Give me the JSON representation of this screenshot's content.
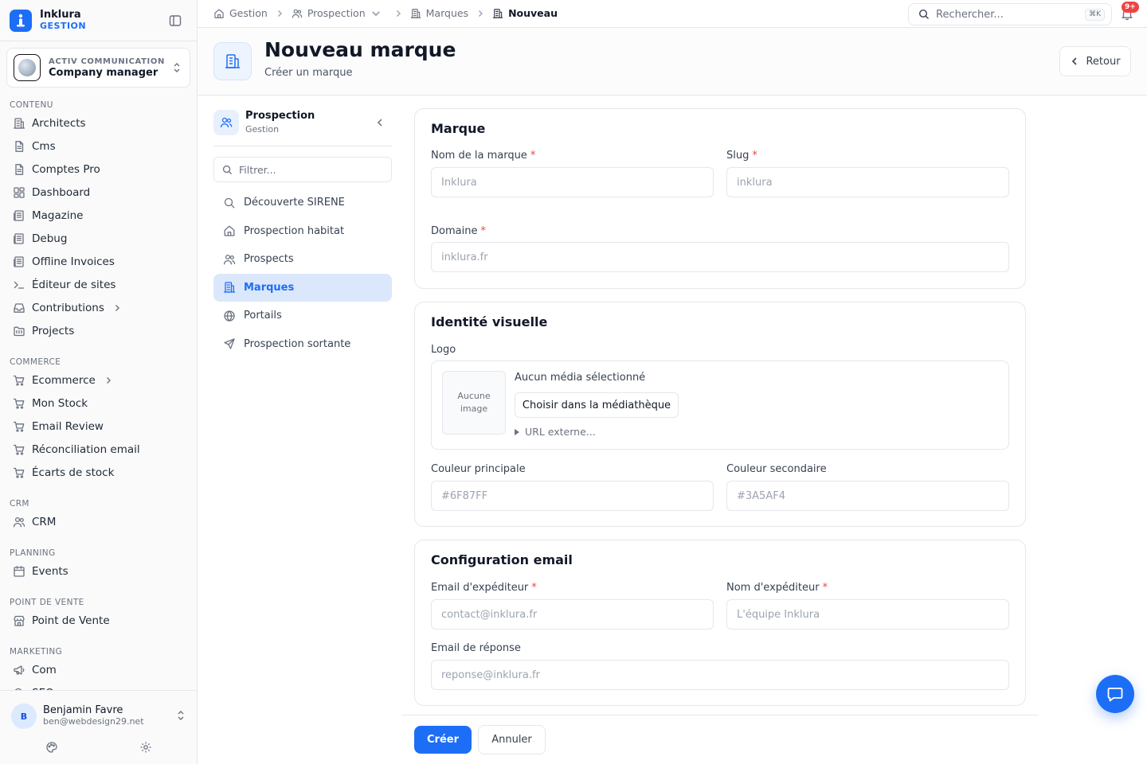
{
  "app": {
    "name": "Inklura",
    "subtitle": "GESTION"
  },
  "org": {
    "tag": "ACTIV COMMUNICATION",
    "name": "Company manager"
  },
  "sidebar": {
    "sections": [
      {
        "title": "CONTENU",
        "items": [
          {
            "label": "Architects",
            "icon": "building-icon"
          },
          {
            "label": "Cms",
            "icon": "document-icon"
          },
          {
            "label": "Comptes Pro",
            "icon": "document-icon"
          },
          {
            "label": "Dashboard",
            "icon": "dashboard-icon"
          },
          {
            "label": "Magazine",
            "icon": "newspaper-icon"
          },
          {
            "label": "Debug",
            "icon": "newspaper-icon"
          },
          {
            "label": "Offline Invoices",
            "icon": "newspaper-icon"
          },
          {
            "label": "Éditeur de sites",
            "icon": "terminal-icon"
          },
          {
            "label": "Contributions",
            "icon": "inbox-icon",
            "expandable": true
          },
          {
            "label": "Projects",
            "icon": "folder-icon"
          }
        ]
      },
      {
        "title": "COMMERCE",
        "items": [
          {
            "label": "Ecommerce",
            "icon": "cart-icon",
            "expandable": true
          },
          {
            "label": "Mon Stock",
            "icon": "cart-icon"
          },
          {
            "label": "Email Review",
            "icon": "cart-icon"
          },
          {
            "label": "Réconciliation email",
            "icon": "cart-icon"
          },
          {
            "label": "Écarts de stock",
            "icon": "cart-icon"
          }
        ]
      },
      {
        "title": "CRM",
        "items": [
          {
            "label": "CRM",
            "icon": "users-icon"
          }
        ]
      },
      {
        "title": "PLANNING",
        "items": [
          {
            "label": "Events",
            "icon": "calendar-icon"
          }
        ]
      },
      {
        "title": "POINT DE VENTE",
        "items": [
          {
            "label": "Point de Vente",
            "icon": "store-icon"
          }
        ]
      },
      {
        "title": "MARKETING",
        "items": [
          {
            "label": "Com",
            "icon": "megaphone-icon"
          },
          {
            "label": "SEO",
            "icon": "search-icon"
          }
        ]
      }
    ]
  },
  "user": {
    "initial": "B",
    "name": "Benjamin Favre",
    "email": "ben@webdesign29.net"
  },
  "breadcrumb": [
    {
      "label": "Gestion",
      "icon": "home-icon"
    },
    {
      "label": "Prospection",
      "icon": "users-icon",
      "dropdown": true
    },
    {
      "label": "Marques",
      "icon": "building-icon"
    },
    {
      "label": "Nouveau",
      "icon": "building-icon",
      "active": true
    }
  ],
  "search": {
    "placeholder": "Rechercher...",
    "shortcut": "⌘K"
  },
  "notifications": {
    "badge": "9+"
  },
  "page": {
    "title": "Nouveau marque",
    "subtitle": "Créer un marque",
    "back_label": "Retour"
  },
  "subnav": {
    "title": "Prospection",
    "subtitle": "Gestion",
    "filter_placeholder": "Filtrer...",
    "items": [
      {
        "label": "Découverte SIRENE",
        "icon": "search-icon"
      },
      {
        "label": "Prospection habitat",
        "icon": "home-icon"
      },
      {
        "label": "Prospects",
        "icon": "users-icon"
      },
      {
        "label": "Marques",
        "icon": "building-icon",
        "active": true
      },
      {
        "label": "Portails",
        "icon": "globe-icon"
      },
      {
        "label": "Prospection sortante",
        "icon": "send-icon"
      }
    ]
  },
  "form": {
    "brand": {
      "title": "Marque",
      "name_label": "Nom de la marque",
      "name_placeholder": "Inklura",
      "slug_label": "Slug",
      "slug_placeholder": "inklura",
      "domain_label": "Domaine",
      "domain_placeholder": "inklura.fr",
      "required": "*"
    },
    "identity": {
      "title": "Identité visuelle",
      "logo_label": "Logo",
      "no_image": "Aucune image",
      "no_media": "Aucun média sélectionné",
      "choose_label": "Choisir dans la médiathèque",
      "external_url": "URL externe...",
      "primary_label": "Couleur principale",
      "primary_placeholder": "#6F87FF",
      "secondary_label": "Couleur secondaire",
      "secondary_placeholder": "#3A5AF4"
    },
    "email": {
      "title": "Configuration email",
      "sender_label": "Email d'expéditeur",
      "sender_placeholder": "contact@inklura.fr",
      "sender_name_label": "Nom d'expéditeur",
      "sender_name_placeholder": "L'équipe Inklura",
      "reply_label": "Email de réponse",
      "reply_placeholder": "reponse@inklura.fr"
    },
    "submit_label": "Créer",
    "cancel_label": "Annuler"
  },
  "colors": {
    "accent": "#1d6ef7",
    "danger": "#ef4444",
    "border": "#e5e7eb"
  }
}
